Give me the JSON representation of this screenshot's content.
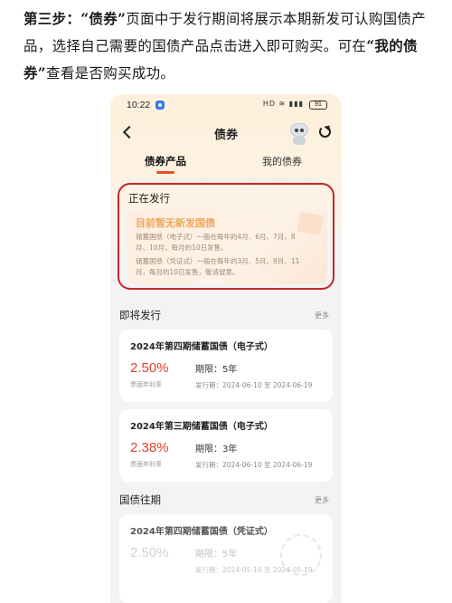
{
  "instruction": {
    "step": "第三步：",
    "q1": "“债券”",
    "text1": "页面中于发行期间将展示本期新发可认购国债产品，选择自己需要的国债产品点击进入即可购买。可在",
    "q2": "“我的债券”",
    "text2": "查看是否购买成功。"
  },
  "status_bar": {
    "time": "10:22",
    "signal": "HD ≋ ▮▮▮",
    "battery": "91"
  },
  "header": {
    "title": "债券"
  },
  "tabs": [
    {
      "label": "债券产品",
      "active": true
    },
    {
      "label": "我的债券",
      "active": false
    }
  ],
  "issuing": {
    "title": "正在发行",
    "notice_headline": "目前暂无新发国债",
    "lines": [
      "储蓄国债（电子式）一般在每年的4月、6月、7月、8",
      "月、10月，每月的10日发售。",
      "储蓄国债（凭证式）一般在每年的3月、5月、9月、11",
      "月，每月的10日发售，敬请留意。"
    ]
  },
  "upcoming": {
    "title": "即将发行",
    "more": "更多",
    "items": [
      {
        "name": "2024年第四期储蓄国债（电子式）",
        "rate": "2.50%",
        "rate_label": "票面年利率",
        "term_label": "期限：",
        "term": "5年",
        "period_label": "发行期：",
        "period": "2024-06-10 至 2024-06-19"
      },
      {
        "name": "2024年第三期储蓄国债（电子式）",
        "rate": "2.38%",
        "rate_label": "票面年利率",
        "term_label": "期限：",
        "term": "3年",
        "period_label": "发行期：",
        "period": "2024-06-10 至 2024-06-19"
      }
    ]
  },
  "past": {
    "title": "国债往期",
    "more": "更多",
    "items": [
      {
        "name": "2024年第四期储蓄国债（凭证式）",
        "rate": "2.50%",
        "term_label": "期限：",
        "term": "5年",
        "period_label": "发行期：",
        "period": "2024-05-10 至 2024-05-19"
      }
    ]
  },
  "colors": {
    "accent": "#e0502a",
    "highlight_box": "#c3262a",
    "rate": "#e0412f",
    "notice_title": "#f0a65a"
  }
}
